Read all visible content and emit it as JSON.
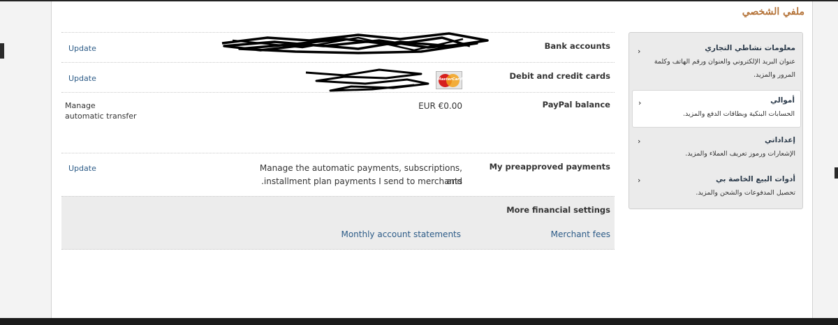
{
  "page": {
    "title": "ملفي الشخصي"
  },
  "financial_rows": [
    {
      "label": "Bank accounts",
      "action": "Update"
    },
    {
      "label": "Debit and credit cards",
      "action": "Update",
      "card_logo": "MasterCard"
    },
    {
      "label": "PayPal balance",
      "value": "EUR €0.00",
      "action_line1": "Manage",
      "action_line2": "automatic transfer"
    },
    {
      "label": "My preapproved payments",
      "action": "Update",
      "desc_line1": "Manage the automatic payments, subscriptions, and",
      "desc_line2": ".installment plan payments I send to merchants"
    }
  ],
  "more_settings": {
    "heading": "More financial settings",
    "links": [
      "Merchant fees",
      "Monthly account statements"
    ]
  },
  "sidebar": {
    "items": [
      {
        "title": "معلومات نشاطي التجاري",
        "desc": "عنوان البريد الإلكتروني والعنوان ورقم الهاتف وكلمة المرور والمزيد."
      },
      {
        "title": "أموالي",
        "desc": "الحسابات البنكية وبطاقات الدفع والمزيد.",
        "active": true
      },
      {
        "title": "إعداداتي",
        "desc": "الإشعارات ورموز تعريف العملاء والمزيد."
      },
      {
        "title": "أدوات البيع الخاصة بي",
        "desc": "تحصيل المدفوعات والشحن والمزيد."
      }
    ]
  },
  "icons": {
    "chevron": "chevron-right-icon",
    "card": "mastercard-logo"
  },
  "colors": {
    "title": "#b5743a",
    "link": "#2c5b87",
    "sidebar_bg": "#ebebeb"
  }
}
